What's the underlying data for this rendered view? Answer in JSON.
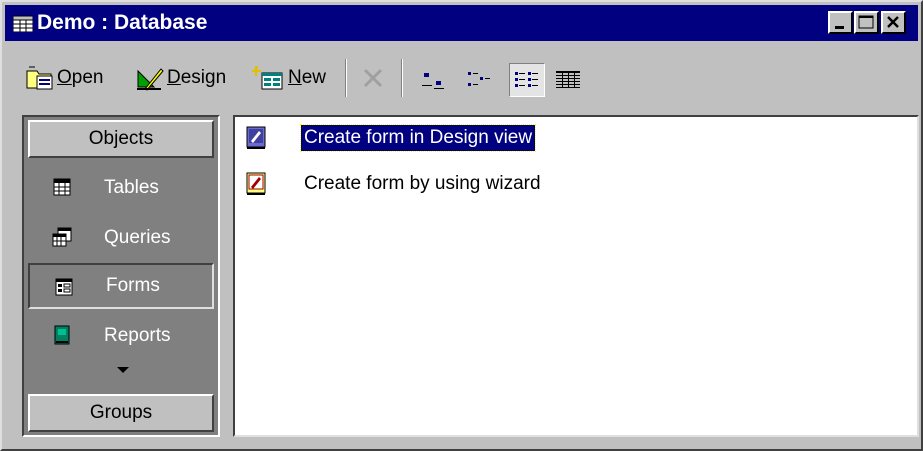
{
  "window": {
    "title": "Demo : Database",
    "title_bar_color": "#000080",
    "controls": [
      "minimize-icon",
      "maximize-icon",
      "close-icon"
    ]
  },
  "toolbar": {
    "open_label": "Open",
    "open_hotkey": "O",
    "design_label": "Design",
    "design_hotkey": "D",
    "new_label": "New",
    "new_hotkey": "N",
    "delete_icon": "delete-x-icon",
    "views": [
      {
        "name": "large-icons-view-icon",
        "active": false
      },
      {
        "name": "small-icons-view-icon",
        "active": false
      },
      {
        "name": "list-view-icon",
        "active": true
      },
      {
        "name": "details-view-icon",
        "active": false
      }
    ]
  },
  "objects_bar": {
    "group_header": "Objects",
    "items": [
      {
        "label": "Tables",
        "icon": "table-icon",
        "active": false
      },
      {
        "label": "Queries",
        "icon": "query-icon",
        "active": false
      },
      {
        "label": "Forms",
        "icon": "form-icon",
        "active": true
      },
      {
        "label": "Reports",
        "icon": "report-icon",
        "active": false
      }
    ],
    "groups_button": "Groups"
  },
  "list": {
    "items": [
      {
        "label": "Create form in Design view",
        "icon": "design-form-icon",
        "selected": true
      },
      {
        "label": "Create form by using wizard",
        "icon": "wizard-form-icon",
        "selected": false
      }
    ]
  }
}
